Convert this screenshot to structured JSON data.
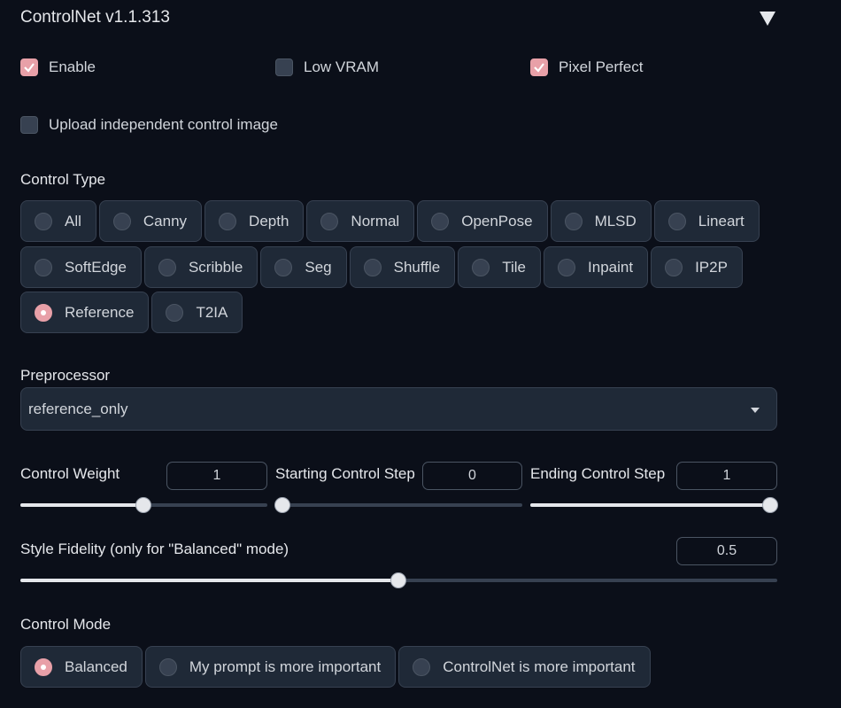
{
  "header": {
    "title": "ControlNet v1.1.313",
    "collapse_icon": "triangle-down-icon"
  },
  "checkboxes": {
    "enable": {
      "label": "Enable",
      "checked": true
    },
    "low_vram": {
      "label": "Low VRAM",
      "checked": false
    },
    "pixel_perfect": {
      "label": "Pixel Perfect",
      "checked": true
    },
    "upload_independent": {
      "label": "Upload independent control image",
      "checked": false
    }
  },
  "control_type": {
    "label": "Control Type",
    "row1": [
      "All",
      "Canny",
      "Depth",
      "Normal",
      "OpenPose",
      "MLSD",
      "Lineart"
    ],
    "row2": [
      "SoftEdge",
      "Scribble",
      "Seg",
      "Shuffle",
      "Tile",
      "Inpaint",
      "IP2P"
    ],
    "row3": [
      "Reference",
      "T2IA"
    ],
    "selected": "Reference"
  },
  "preprocessor": {
    "label": "Preprocessor",
    "value": "reference_only"
  },
  "sliders": {
    "control_weight": {
      "label": "Control Weight",
      "value": "1",
      "fraction": 0.5
    },
    "starting_step": {
      "label": "Starting Control Step",
      "value": "0",
      "fraction": 0.0
    },
    "ending_step": {
      "label": "Ending Control Step",
      "value": "1",
      "fraction": 1.0
    },
    "style_fidelity": {
      "label": "Style Fidelity (only for \"Balanced\" mode)",
      "value": "0.5",
      "fraction": 0.5
    }
  },
  "control_mode": {
    "label": "Control Mode",
    "options": [
      "Balanced",
      "My prompt is more important",
      "ControlNet is more important"
    ],
    "selected": "Balanced"
  },
  "colors": {
    "background": "#0b0f19",
    "accent": "#e8a0a8",
    "panel": "#1f2937"
  }
}
